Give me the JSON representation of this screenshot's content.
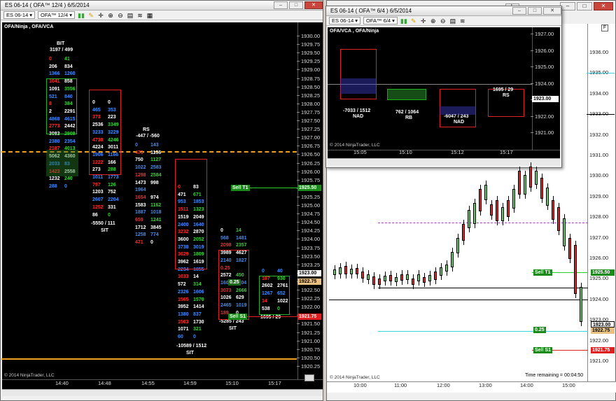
{
  "desktop_buttons": [
    "L",
    "L"
  ],
  "left_window": {
    "title": "ES 06-14 ( OFA™ 12/4 )  6/5/2014",
    "toolbar": {
      "instrument": "ES 06-14",
      "period": "OFA™ 12/4"
    },
    "chart_label": "OFA/Ninja , OFA/VCA",
    "copyright": "© 2014 NinjaTrader, LLC",
    "yaxis": [
      "1930.00",
      "1929.75",
      "1929.50",
      "1929.25",
      "1929.00",
      "1928.75",
      "1928.50",
      "1928.25",
      "1928.00",
      "1927.75",
      "1927.50",
      "1927.25",
      "1927.00",
      "1926.75",
      "1926.50",
      "1926.25",
      "1926.00",
      "1925.75",
      "1925.50",
      "1925.25",
      "1925.00",
      "1924.75",
      "1924.50",
      "1924.25",
      "1924.00",
      "1923.75",
      "1923.50",
      "1923.25",
      "1923.00",
      "1922.75",
      "1922.50",
      "1922.25",
      "1922.00",
      "1921.75",
      "1921.50",
      "1921.25",
      "1921.00",
      "1920.75",
      "1920.50",
      "1920.25"
    ],
    "xaxis": [
      "14:40",
      "14:48",
      "14:55",
      "14:59",
      "15:10",
      "15:17"
    ],
    "price_tags": {
      "t1": "1925.50",
      "current": "1923.00",
      "mid": "1922.75",
      "s1": "1921.75"
    },
    "order_labels": {
      "t1": "Sell T1",
      "q": "0.25",
      "s1": "Sell S1"
    },
    "bars": [
      {
        "label": "BIT",
        "summary": "3197 / 499",
        "bottom": "",
        "sig": "",
        "rows": [
          [
            "0",
            "41"
          ],
          [
            "206",
            "834"
          ],
          [
            "1366",
            "1260"
          ],
          [
            "1041",
            "858"
          ],
          [
            "1091",
            "3556"
          ],
          [
            "521",
            "840"
          ],
          [
            "8",
            "384"
          ],
          [
            "2",
            "2291"
          ],
          [
            "4868",
            "4615"
          ],
          [
            "2773",
            "2442"
          ],
          [
            "3083",
            "2909"
          ],
          [
            "2380",
            "2354"
          ],
          [
            "2187",
            "4013"
          ],
          [
            "5062",
            "4360"
          ],
          [
            "2033",
            "83"
          ],
          [
            "1423",
            "2558"
          ],
          [
            "1232",
            "240"
          ],
          [
            "288",
            "0"
          ]
        ]
      },
      {
        "label": "",
        "summary": "",
        "bottom": "-5550 / 111",
        "sig": "SIT",
        "rows": [
          [
            "0",
            "0"
          ],
          [
            "465",
            "353"
          ],
          [
            "373",
            "223"
          ],
          [
            "2536",
            "3349"
          ],
          [
            "3233",
            "3229"
          ],
          [
            "4738",
            "4246"
          ],
          [
            "4224",
            "3011"
          ],
          [
            "1906",
            "1166"
          ],
          [
            "1222",
            "166"
          ],
          [
            "273",
            "288"
          ],
          [
            "1011",
            "1773"
          ],
          [
            "797",
            "126"
          ],
          [
            "1203",
            "752"
          ],
          [
            "2607",
            "2204"
          ],
          [
            "1252",
            "331"
          ],
          [
            "86",
            "0"
          ]
        ]
      },
      {
        "label": "RS",
        "summary": "-447 / -560",
        "bottom": "",
        "sig": "",
        "rows": [
          [
            "0",
            "143"
          ],
          [
            "473",
            "1156"
          ],
          [
            "750",
            "1127"
          ],
          [
            "1022",
            "2583"
          ],
          [
            "1298",
            "2584"
          ],
          [
            "1473",
            "998"
          ],
          [
            "1964",
            ""
          ],
          [
            "1654",
            "974"
          ],
          [
            "1583",
            "1162"
          ],
          [
            "1887",
            "1018"
          ],
          [
            "659",
            "1241"
          ],
          [
            "1712",
            "3845"
          ],
          [
            "1258",
            "774"
          ],
          [
            "471",
            "0"
          ]
        ]
      },
      {
        "label": "",
        "summary": "",
        "bottom": "-10589 / 1512",
        "sig": "SIT",
        "rows": [
          [
            "0",
            "83"
          ],
          [
            "471",
            "671"
          ],
          [
            "953",
            "1853"
          ],
          [
            "1511",
            "1323"
          ],
          [
            "1519",
            "2049"
          ],
          [
            "2400",
            "1640"
          ],
          [
            "3232",
            "2870"
          ],
          [
            "3600",
            "2052"
          ],
          [
            "3738",
            "3019"
          ],
          [
            "3029",
            "1809"
          ],
          [
            "3962",
            "1619"
          ],
          [
            "2234",
            "1055"
          ],
          [
            "1033",
            "14"
          ],
          [
            "572",
            "314"
          ],
          [
            "2326",
            "1606"
          ],
          [
            "1565",
            "1570"
          ],
          [
            "3952",
            "1414"
          ],
          [
            "1380",
            "837"
          ],
          [
            "1503",
            "1730"
          ],
          [
            "1071",
            "321"
          ],
          [
            "60",
            "0"
          ]
        ]
      },
      {
        "label": "",
        "summary": "",
        "bottom": "-5285 / 243",
        "sig": "SIT",
        "rows": [
          [
            "0",
            "14"
          ],
          [
            "568",
            "1481"
          ],
          [
            "2098",
            "2357"
          ],
          [
            "3989",
            "4627"
          ],
          [
            "2140",
            "1827"
          ],
          [
            "0.25",
            ""
          ],
          [
            "2572",
            "450"
          ],
          [
            "1603",
            "1104"
          ],
          [
            "3073",
            "2666"
          ],
          [
            "1026",
            "629"
          ],
          [
            "2465",
            "1019"
          ],
          [
            "189",
            "0"
          ]
        ]
      },
      {
        "label": "",
        "summary": "",
        "bottom": "1695 / 29",
        "sig": "",
        "rows": [
          [
            "0",
            "40"
          ],
          [
            "187",
            "930"
          ],
          [
            "2602",
            "2761"
          ],
          [
            "1267",
            "652"
          ],
          [
            "14",
            "1022"
          ],
          [
            "538",
            "0"
          ]
        ]
      }
    ]
  },
  "right_window": {
    "title": "ES 06-14 ( OFA™ 6/4 )  6/5/2014",
    "toolbar": {
      "instrument": "ES 06-14",
      "period": "OFA™ 6/4"
    },
    "chart_label": "OFA/VCA , OFA/Ninja",
    "copyright": "© 2014 NinjaTrader, LLC",
    "yaxis": [
      "1927.00",
      "1926.00",
      "1925.00",
      "1924.00",
      "1923.00",
      "1922.00",
      "1921.00"
    ],
    "current_tag": "1923.00",
    "xaxis": [
      "15:05",
      "15:10",
      "15:12",
      "15:17"
    ],
    "bars": [
      {
        "label": "NAD",
        "summary": "-7033 / 1512"
      },
      {
        "label": "RB",
        "summary": "762 / 1064"
      },
      {
        "label": "NAD",
        "summary": "-6047 / 243"
      },
      {
        "label": "RS",
        "summary": "1695 / 29"
      }
    ]
  },
  "back_chart": {
    "yaxis": [
      "1936.00",
      "1935.00",
      "1934.00",
      "1933.00",
      "1932.00",
      "1931.00",
      "1930.00",
      "1929.00",
      "1928.00",
      "1927.00",
      "1926.00",
      "1925.00",
      "1924.00",
      "1923.00",
      "1922.00",
      "1921.00"
    ],
    "xaxis": [
      "10:00",
      "11:00",
      "12:00",
      "13:00",
      "14:00",
      "15:00"
    ],
    "copyright": "© 2014 NinjaTrader, LLC",
    "time_remaining": "Time remaining = 00:04:50",
    "tags": {
      "t1": "1925.50",
      "cur": "1923.00",
      "t2": "1922.75",
      "s1": "1921.75"
    },
    "order_labels": {
      "t1": "Sell T1",
      "q": "0.25",
      "s1": "Sell S1"
    }
  },
  "colors": {
    "bg": "#000000",
    "sell": "#ff2b2b",
    "buy": "#35d435",
    "neutral": "#3d8cff",
    "poc_line": "#f0a020"
  }
}
